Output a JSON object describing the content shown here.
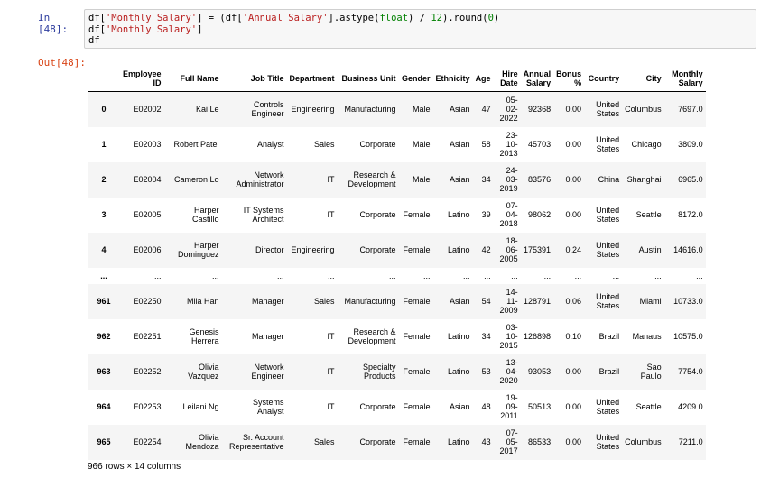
{
  "cell_in": {
    "prompt": "In [48]:",
    "code_line1_a": "df[",
    "code_line1_b": "'Monthly Salary'",
    "code_line1_c": "] = (df[",
    "code_line1_d": "'Annual Salary'",
    "code_line1_e": "].astype(",
    "code_line1_f": "float",
    "code_line1_g": ") / ",
    "code_line1_h": "12",
    "code_line1_i": ").round(",
    "code_line1_j": "0",
    "code_line1_k": ")",
    "code_line2_a": "df[",
    "code_line2_b": "'Monthly Salary'",
    "code_line2_c": "]",
    "code_line3": "df"
  },
  "cell_out": {
    "prompt": "Out[48]:"
  },
  "table": {
    "headers": [
      "",
      "Employee ID",
      "Full Name",
      "Job Title",
      "Department",
      "Business Unit",
      "Gender",
      "Ethnicity",
      "Age",
      "Hire Date",
      "Annual Salary",
      "Bonus %",
      "Country",
      "City",
      "Monthly Salary"
    ],
    "rows": [
      [
        "0",
        "E02002",
        "Kai Le",
        "Controls Engineer",
        "Engineering",
        "Manufacturing",
        "Male",
        "Asian",
        "47",
        "05-02-2022",
        "92368",
        "0.00",
        "United States",
        "Columbus",
        "7697.0"
      ],
      [
        "1",
        "E02003",
        "Robert Patel",
        "Analyst",
        "Sales",
        "Corporate",
        "Male",
        "Asian",
        "58",
        "23-10-2013",
        "45703",
        "0.00",
        "United States",
        "Chicago",
        "3809.0"
      ],
      [
        "2",
        "E02004",
        "Cameron Lo",
        "Network Administrator",
        "IT",
        "Research & Development",
        "Male",
        "Asian",
        "34",
        "24-03-2019",
        "83576",
        "0.00",
        "China",
        "Shanghai",
        "6965.0"
      ],
      [
        "3",
        "E02005",
        "Harper Castillo",
        "IT Systems Architect",
        "IT",
        "Corporate",
        "Female",
        "Latino",
        "39",
        "07-04-2018",
        "98062",
        "0.00",
        "United States",
        "Seattle",
        "8172.0"
      ],
      [
        "4",
        "E02006",
        "Harper Dominguez",
        "Director",
        "Engineering",
        "Corporate",
        "Female",
        "Latino",
        "42",
        "18-06-2005",
        "175391",
        "0.24",
        "United States",
        "Austin",
        "14616.0"
      ],
      [
        "...",
        "...",
        "...",
        "...",
        "...",
        "...",
        "...",
        "...",
        "...",
        "...",
        "...",
        "...",
        "...",
        "...",
        "..."
      ],
      [
        "961",
        "E02250",
        "Mila Han",
        "Manager",
        "Sales",
        "Manufacturing",
        "Female",
        "Asian",
        "54",
        "14-11-2009",
        "128791",
        "0.06",
        "United States",
        "Miami",
        "10733.0"
      ],
      [
        "962",
        "E02251",
        "Genesis Herrera",
        "Manager",
        "IT",
        "Research & Development",
        "Female",
        "Latino",
        "34",
        "03-10-2015",
        "126898",
        "0.10",
        "Brazil",
        "Manaus",
        "10575.0"
      ],
      [
        "963",
        "E02252",
        "Olivia Vazquez",
        "Network Engineer",
        "IT",
        "Specialty Products",
        "Female",
        "Latino",
        "53",
        "13-04-2020",
        "93053",
        "0.00",
        "Brazil",
        "Sao Paulo",
        "7754.0"
      ],
      [
        "964",
        "E02253",
        "Leilani Ng",
        "Systems Analyst",
        "IT",
        "Corporate",
        "Female",
        "Asian",
        "48",
        "19-09-2011",
        "50513",
        "0.00",
        "United States",
        "Seattle",
        "4209.0"
      ],
      [
        "965",
        "E02254",
        "Olivia Mendoza",
        "Sr. Account Representative",
        "Sales",
        "Corporate",
        "Female",
        "Latino",
        "43",
        "07-05-2017",
        "86533",
        "0.00",
        "United States",
        "Columbus",
        "7211.0"
      ]
    ]
  },
  "footer": "966 rows × 14 columns"
}
